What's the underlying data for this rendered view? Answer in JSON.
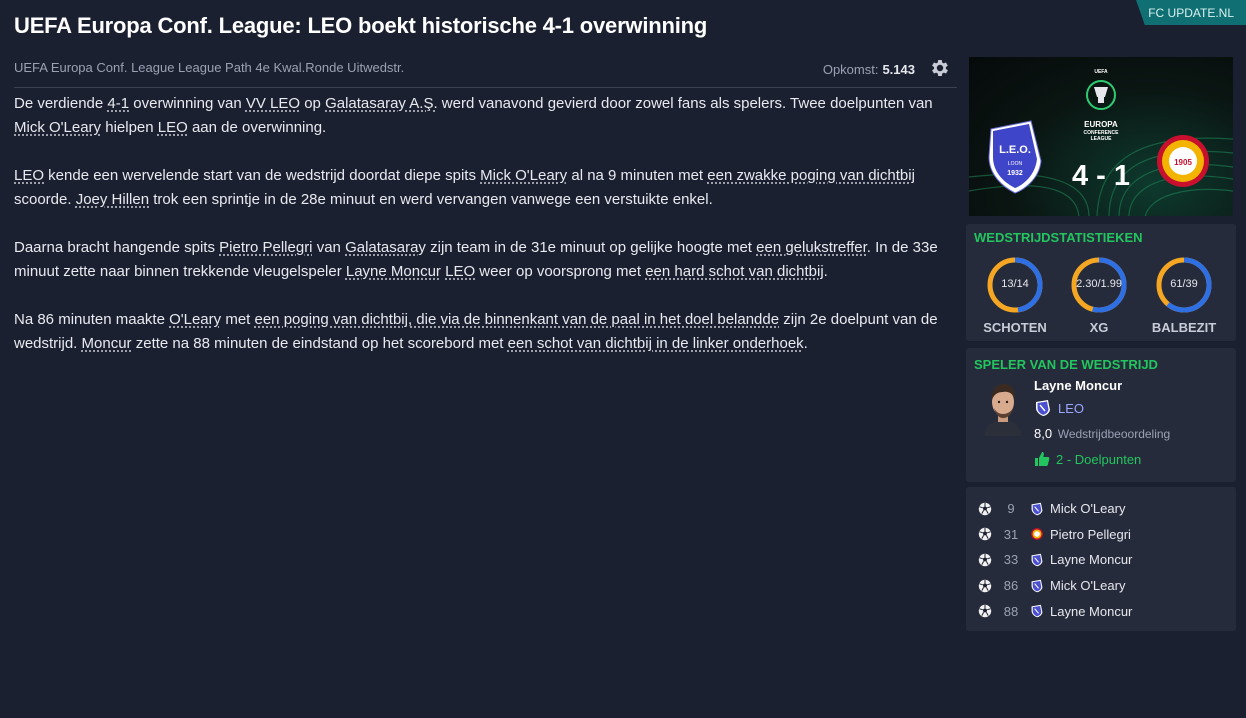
{
  "corner_tag": "FC UPDATE.NL",
  "headline": "UEFA Europa Conf. League: LEO boekt historische 4-1 overwinning",
  "subheader": {
    "competition": "UEFA Europa Conf. League League Path 4e Kwal.Ronde Uitwedstr.",
    "attendance_label": "Opkomst:",
    "attendance_value": "5.143"
  },
  "article": {
    "p1": {
      "t1": "De verdiende ",
      "score": "4-1",
      "t2": " overwinning van ",
      "team": "VV LEO",
      "t3": " op ",
      "opponent": "Galatasaray A.Ş.",
      "t4": " werd vanavond gevierd door zowel fans als spelers. Twee doelpunten van ",
      "player": "Mick O'Leary",
      "t5": " hielpen ",
      "team2": "LEO",
      "t6": " aan de overwinning."
    },
    "p2": {
      "team": "LEO",
      "t1": " kende een wervelende start van de wedstrijd doordat diepe spits ",
      "player": "Mick O'Leary",
      "t2": " al na 9 minuten met ",
      "goal_desc": "een zwakke poging van dichtbij",
      "t3": " scoorde. ",
      "player2": "Joey Hillen",
      "t4": " trok een sprintje in de 28e minuut en werd vervangen vanwege een verstuikte enkel."
    },
    "p3": {
      "t1": "Daarna bracht hangende spits ",
      "player": "Pietro Pellegri",
      "t2": " van ",
      "team": "Galatasaray",
      "t3": " zijn team in de 31e minuut op gelijke hoogte met ",
      "goal_desc": "een gelukstreffer",
      "t4": ". In de 33e minuut zette naar binnen trekkende vleugelspeler ",
      "player2": "Layne Moncur",
      "t5": " ",
      "team2": "LEO",
      "t6": " weer op voorsprong met ",
      "goal_desc2": "een hard schot van dichtbij",
      "t7": "."
    },
    "p4": {
      "t1": "Na 86 minuten maakte ",
      "player": "O'Leary",
      "t2": " met ",
      "goal_desc": "een poging van dichtbij, die via de binnenkant van de paal in het doel belandde",
      "t3": " zijn 2e doelpunt van de wedstrijd. ",
      "player2": "Moncur",
      "t4": " zette na 88 minuten de eindstand op het scorebord met ",
      "goal_desc2": "een schot van dichtbij in de linker onderhoek",
      "t5": "."
    }
  },
  "banner": {
    "competition_logo_text": [
      "EUROPA",
      "CONFERENCE",
      "LEAGUE"
    ],
    "home_crest_text": [
      "L.E.O.",
      "LOON",
      "1932"
    ],
    "score": "4 - 1",
    "away_crest_text": "1905"
  },
  "stats": {
    "title": "WEDSTRIJDSTATISTIEKEN",
    "items": [
      {
        "label": "SCHOTEN",
        "value": "13/14",
        "home_share": 0.48
      },
      {
        "label": "XG",
        "value": "2.30/1.99",
        "home_share": 0.54
      },
      {
        "label": "BALBEZIT",
        "value": "61/39",
        "home_share": 0.61
      }
    ],
    "home_color": "#2f6fe4",
    "away_color": "#f5a623"
  },
  "potm": {
    "title": "SPELER VAN DE WEDSTRIJD",
    "name": "Layne Moncur",
    "club": "LEO",
    "rating": "8,0",
    "rating_label": "Wedstrijdbeoordeling",
    "goals": "2 - Doelpunten"
  },
  "events": [
    {
      "minute": "9",
      "player": "Mick O'Leary",
      "team": "home"
    },
    {
      "minute": "31",
      "player": "Pietro Pellegri",
      "team": "away"
    },
    {
      "minute": "33",
      "player": "Layne Moncur",
      "team": "home"
    },
    {
      "minute": "86",
      "player": "Mick O'Leary",
      "team": "home"
    },
    {
      "minute": "88",
      "player": "Layne Moncur",
      "team": "home"
    }
  ],
  "colors": {
    "accent_green": "#22c55e",
    "banner_teal": "#0f6f72",
    "leo_purple": "#6b6fd8",
    "gala_red": "#c8102e",
    "gala_yellow": "#f2b400"
  }
}
